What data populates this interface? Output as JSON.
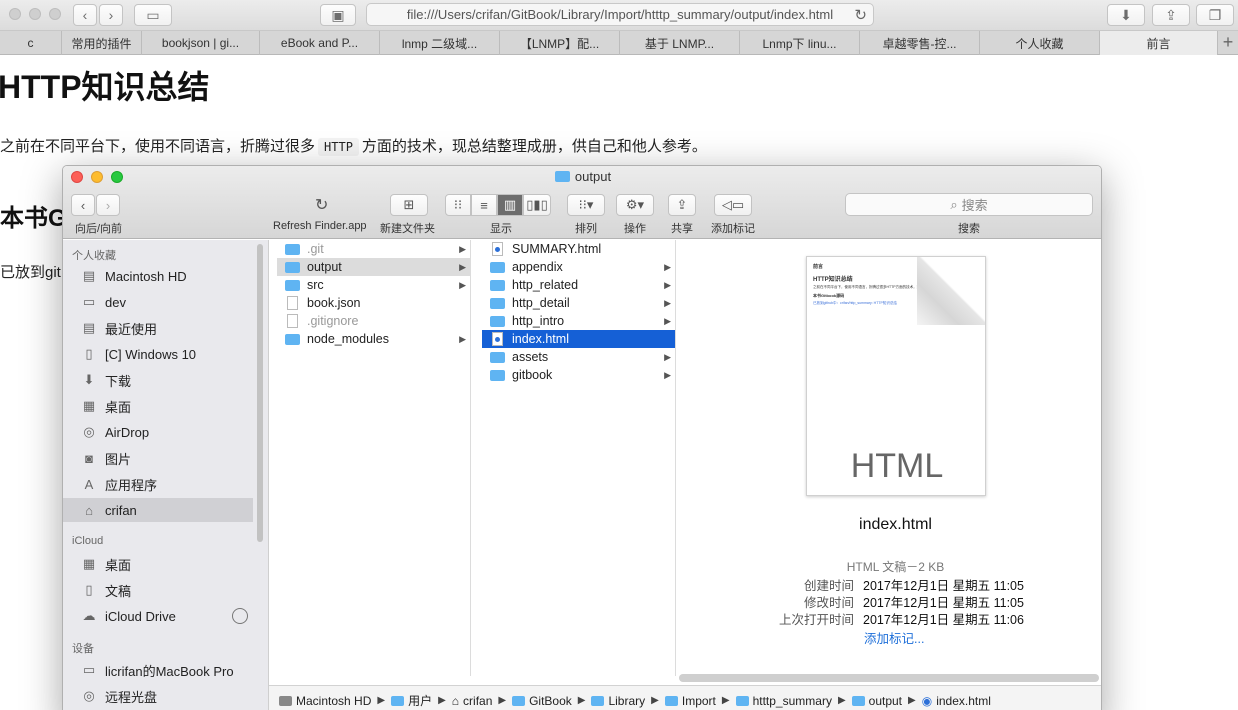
{
  "browser": {
    "url": "file:///Users/crifan/GitBook/Library/Import/htttp_summary/output/index.html",
    "tabs": [
      "c",
      "常用的插件",
      "bookjson | gi...",
      "eBook and P...",
      "lnmp 二级域...",
      "【LNMP】配...",
      "基于 LNMP...",
      "Lnmp下 linu...",
      "卓越零售-控...",
      "个人收藏",
      "前言"
    ],
    "new_tab": "+"
  },
  "page": {
    "title": "HTTP知识总结",
    "para_before": "之前在不同平台下，使用不同语言，折腾过很多",
    "para_code": "HTTP",
    "para_after": "方面的技术，现总结整理成册，供自己和他人参考。",
    "heading2": "本书G",
    "para2": "已放到git"
  },
  "finder": {
    "title": "output",
    "toolbar": {
      "nav_label": "向后/向前",
      "refresh_label": "Refresh Finder.app",
      "new_folder_label": "新建文件夹",
      "view_label": "显示",
      "arrange_label": "排列",
      "action_label": "操作",
      "share_label": "共享",
      "tag_label": "添加标记",
      "search_placeholder": "搜索",
      "search_label": "搜索"
    },
    "sidebar": {
      "favorites_header": "个人收藏",
      "favorites": [
        {
          "label": "Macintosh HD",
          "icon": "hard-drive-icon"
        },
        {
          "label": "dev",
          "icon": "folder-icon"
        },
        {
          "label": "最近使用",
          "icon": "recents-icon"
        },
        {
          "label": "[C] Windows 10",
          "icon": "document-icon"
        },
        {
          "label": "下载",
          "icon": "download-icon"
        },
        {
          "label": "桌面",
          "icon": "desktop-icon"
        },
        {
          "label": "AirDrop",
          "icon": "airdrop-icon"
        },
        {
          "label": "图片",
          "icon": "camera-icon"
        },
        {
          "label": "应用程序",
          "icon": "applications-icon"
        },
        {
          "label": "crifan",
          "icon": "home-icon"
        }
      ],
      "icloud_header": "iCloud",
      "icloud": [
        {
          "label": "桌面",
          "icon": "desktop-icon"
        },
        {
          "label": "文稿",
          "icon": "documents-icon"
        },
        {
          "label": "iCloud Drive",
          "icon": "cloud-icon"
        }
      ],
      "devices_header": "设备",
      "devices": [
        {
          "label": "licrifan的MacBook Pro",
          "icon": "laptop-icon"
        },
        {
          "label": "远程光盘",
          "icon": "disc-icon"
        }
      ]
    },
    "column1": [
      {
        "label": ".git",
        "kind": "folder",
        "dim": true,
        "chevron": true
      },
      {
        "label": "output",
        "kind": "folder",
        "dim": false,
        "chevron": true
      },
      {
        "label": "src",
        "kind": "folder",
        "dim": false,
        "chevron": true
      },
      {
        "label": "book.json",
        "kind": "doc",
        "dim": false,
        "chevron": false
      },
      {
        "label": ".gitignore",
        "kind": "doc",
        "dim": true,
        "chevron": false
      },
      {
        "label": "node_modules",
        "kind": "folder",
        "dim": false,
        "chevron": true
      }
    ],
    "column2": [
      {
        "label": "SUMMARY.html",
        "kind": "html",
        "chevron": false
      },
      {
        "label": "appendix",
        "kind": "folder",
        "chevron": true
      },
      {
        "label": "http_related",
        "kind": "folder",
        "chevron": true
      },
      {
        "label": "http_detail",
        "kind": "folder",
        "chevron": true
      },
      {
        "label": "http_intro",
        "kind": "folder",
        "chevron": true
      },
      {
        "label": "index.html",
        "kind": "html",
        "chevron": false
      },
      {
        "label": "assets",
        "kind": "folder",
        "chevron": true
      },
      {
        "label": "gitbook",
        "kind": "folder",
        "chevron": true
      }
    ],
    "preview": {
      "doc_mini_heading": "前言",
      "doc_mini_title": "HTTP知识总结",
      "doc_mini_line1": "之前在不同平台下，使用不同语言，折腾过很多HTTP方面的技术，现总结整理成册，供自己...",
      "doc_mini_h2": "本书Gitbook源码",
      "doc_mini_line2": "已放到github中：crifan/http_summary: HTTP知识总结",
      "badge": "HTML",
      "name": "index.html",
      "kind": "HTML 文稿－2 KB",
      "created_label": "创建时间",
      "created_value": "2017年12月1日 星期五 11:05",
      "modified_label": "修改时间",
      "modified_value": "2017年12月1日 星期五 11:05",
      "opened_label": "上次打开时间",
      "opened_value": "2017年12月1日 星期五 11:06",
      "add_tag": "添加标记..."
    },
    "path": [
      "Macintosh HD",
      "用户",
      "crifan",
      "GitBook",
      "Library",
      "Import",
      "htttp_summary",
      "output",
      "index.html"
    ]
  }
}
